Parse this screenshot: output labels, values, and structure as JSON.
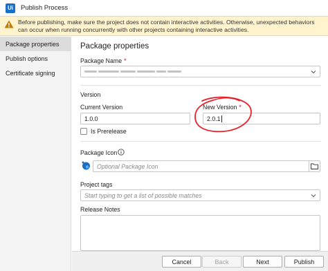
{
  "window": {
    "title": "Publish Process",
    "app_icon": "Ui"
  },
  "warning": {
    "icon": "warning-triangle-icon",
    "text": "Before publishing, make sure the project does not contain interactive activities. Otherwise, unexpected behaviors can occur when running concurrently with other projects containing interactive activities."
  },
  "sidebar": {
    "items": [
      {
        "label": "Package properties",
        "active": true
      },
      {
        "label": "Publish options",
        "active": false
      },
      {
        "label": "Certificate signing",
        "active": false
      }
    ]
  },
  "main": {
    "heading": "Package properties",
    "package_name": {
      "label": "Package Name",
      "required_mark": "*"
    },
    "version": {
      "section_label": "Version",
      "current_label": "Current Version",
      "current_value": "1.0.0",
      "new_label": "New Version",
      "required_mark": "*",
      "new_value": "2.0.1",
      "prerelease_label": "Is Prerelease",
      "prerelease_checked": false
    },
    "package_icon": {
      "label": "Package Icon",
      "help_icon": "info-circle-icon",
      "placeholder": "Optional Package Icon",
      "browse_icon": "folder-icon"
    },
    "project_tags": {
      "label": "Project tags",
      "placeholder": "Start typing to get a list of possible matches"
    },
    "release_notes": {
      "label": "Release Notes"
    }
  },
  "footer": {
    "cancel": "Cancel",
    "back": "Back",
    "next": "Next",
    "publish": "Publish"
  },
  "colors": {
    "annotation": "#e8202a",
    "warning_bg": "#fff4ce",
    "accent": "#1a6fc9"
  }
}
